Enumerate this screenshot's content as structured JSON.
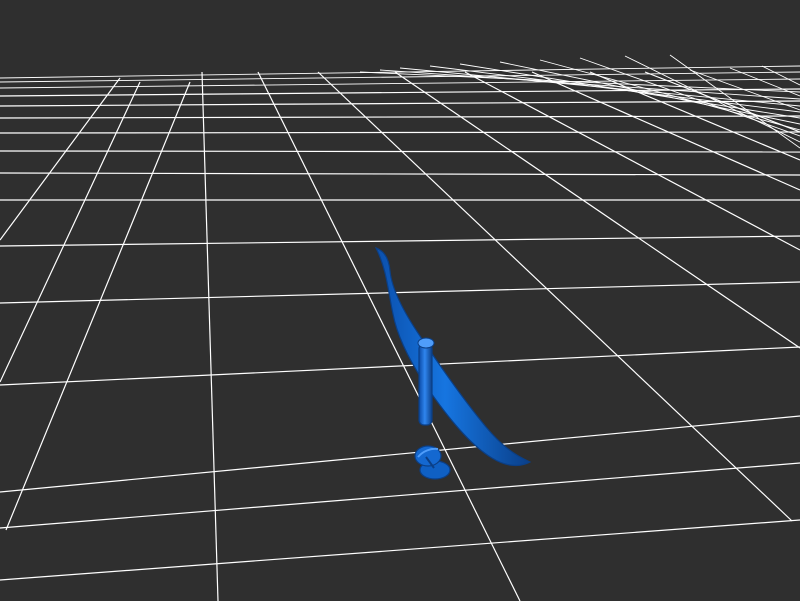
{
  "viewport": {
    "background_color": "#2f2f2f",
    "grid_color": "#ffffff",
    "object_color": "#1163c9",
    "object_shadow_color": "#0b3f86",
    "object_highlight_color": "#3f8ff0"
  },
  "scene": {
    "objects": [
      {
        "name": "curved-blade",
        "type": "mesh"
      },
      {
        "name": "vertical-pin",
        "type": "cylinder"
      },
      {
        "name": "split-washer",
        "type": "mesh"
      }
    ]
  }
}
